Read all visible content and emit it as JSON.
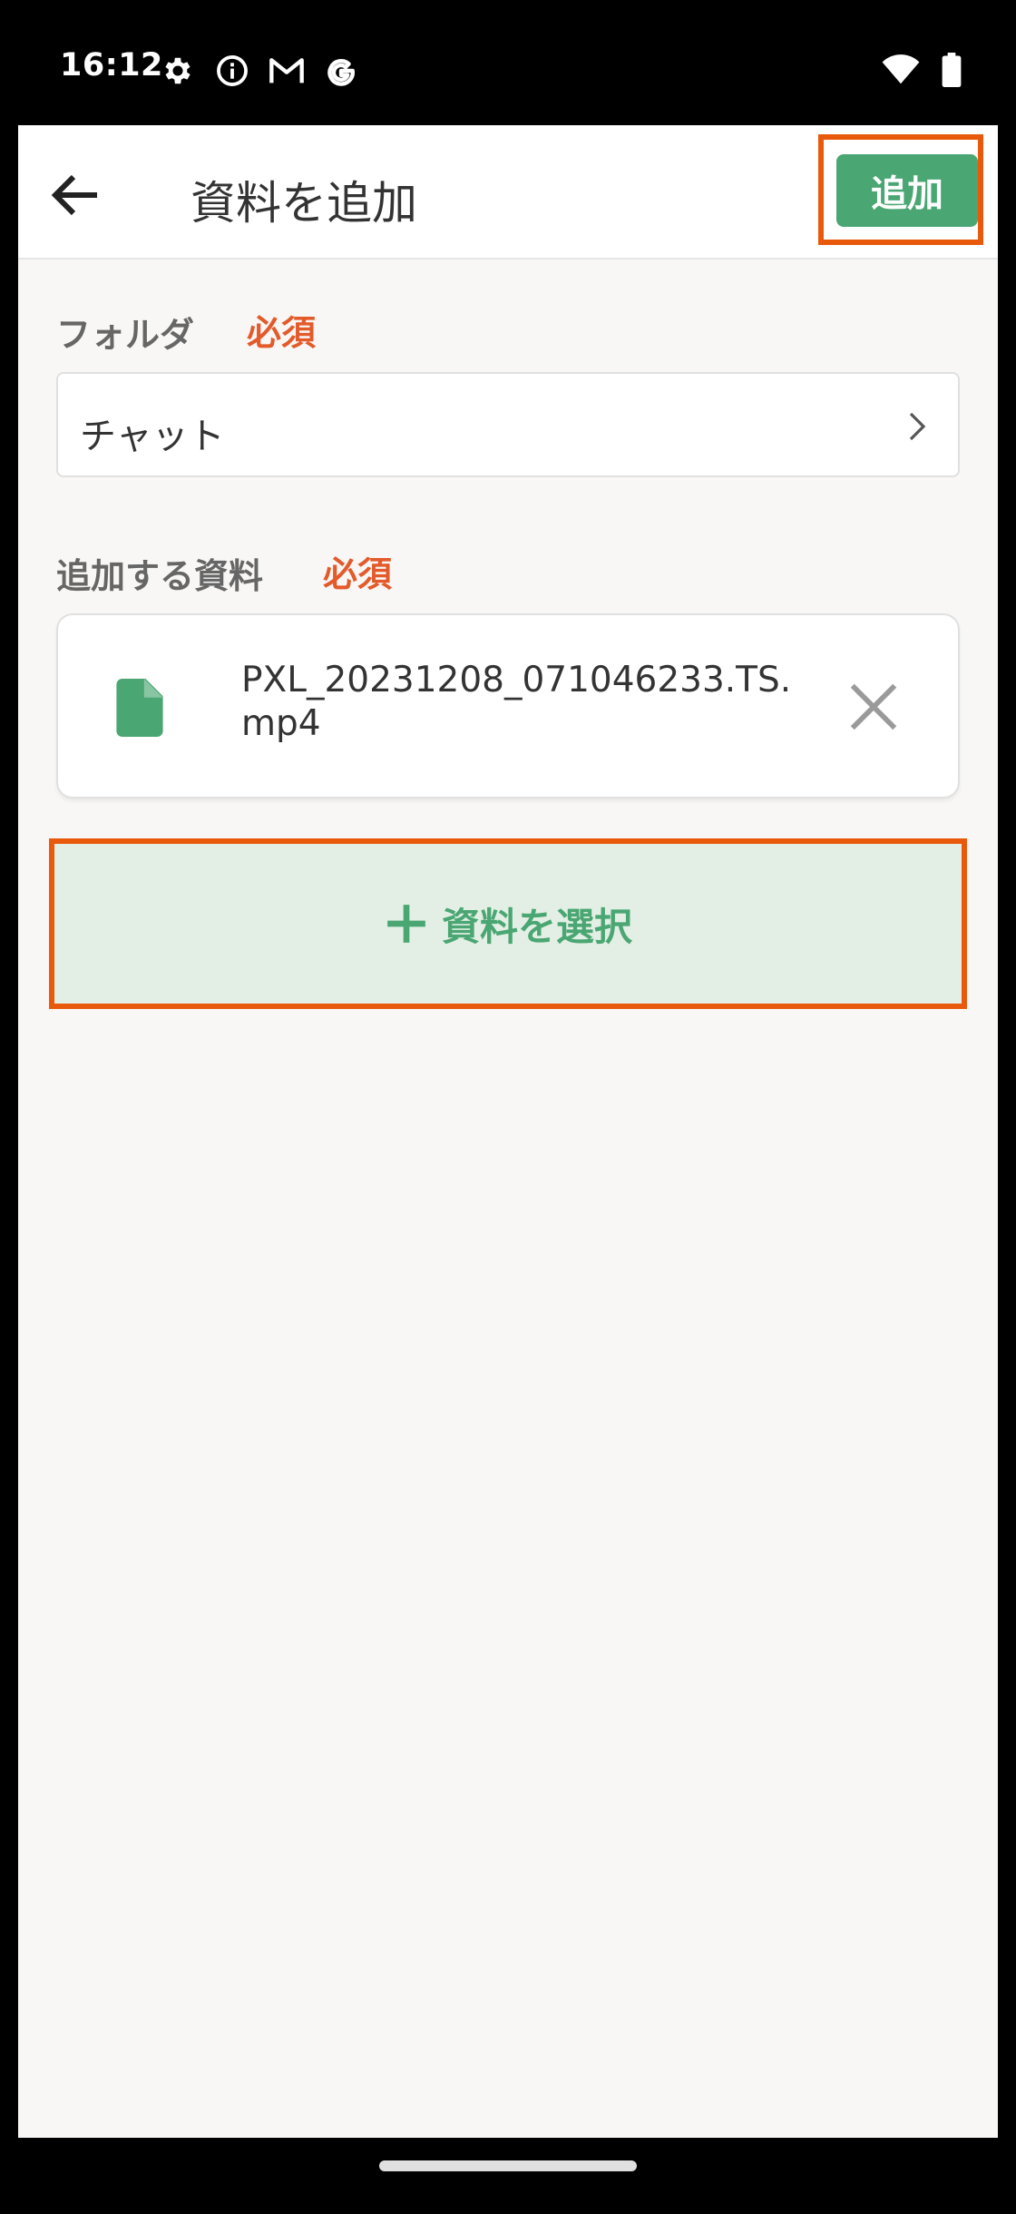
{
  "status_bar": {
    "time": "16:12",
    "left_icons": [
      "settings-icon",
      "info-icon",
      "gmail-icon",
      "google-icon"
    ],
    "right_icons": [
      "wifi-icon",
      "battery-icon"
    ]
  },
  "app_bar": {
    "title": "資料を追加",
    "add_label": "追加"
  },
  "folder": {
    "label": "フォルダ",
    "required": "必須",
    "value": "チャット"
  },
  "materials": {
    "label": "追加する資料",
    "required": "必須",
    "files": [
      {
        "name": "PXL_20231208_071046233.TS.mp4"
      }
    ],
    "select_label": "資料を選択"
  },
  "colors": {
    "accent": "#4aa672",
    "required": "#e35a2b",
    "highlight": "#e8590c",
    "background": "#f8f7f5"
  }
}
